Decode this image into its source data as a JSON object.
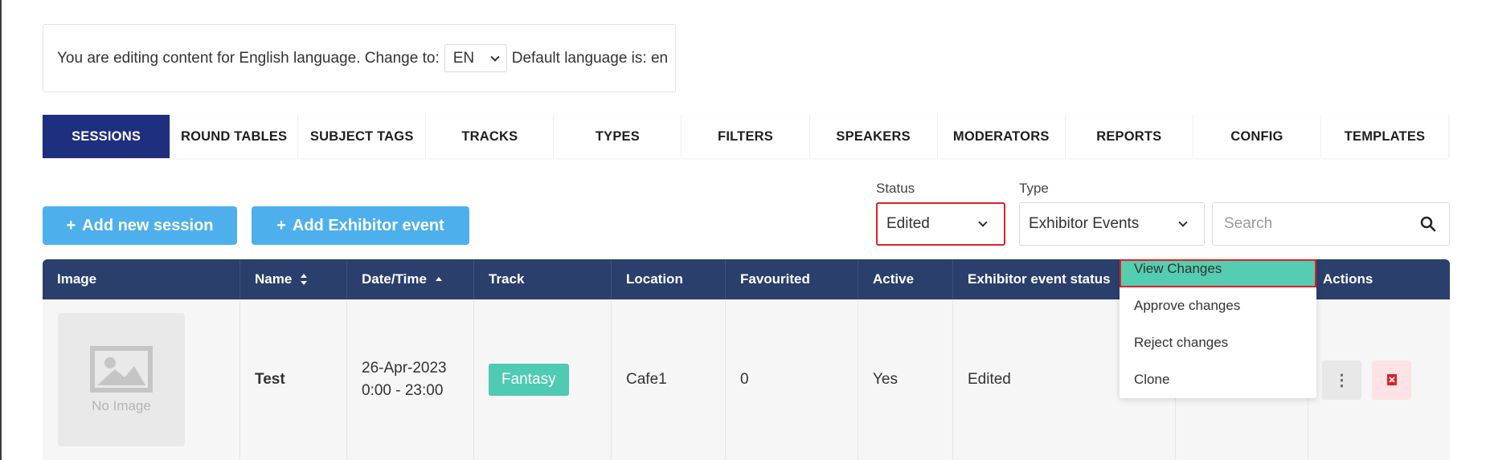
{
  "language_bar": {
    "prefix": "You are editing content for English language. Change to:",
    "selected": "EN",
    "suffix": "Default language is: en"
  },
  "tabs": [
    {
      "label": "SESSIONS",
      "active": true
    },
    {
      "label": "ROUND TABLES"
    },
    {
      "label": "SUBJECT TAGS"
    },
    {
      "label": "TRACKS"
    },
    {
      "label": "TYPES"
    },
    {
      "label": "FILTERS"
    },
    {
      "label": "SPEAKERS"
    },
    {
      "label": "MODERATORS"
    },
    {
      "label": "REPORTS"
    },
    {
      "label": "CONFIG"
    },
    {
      "label": "TEMPLATES"
    }
  ],
  "buttons": {
    "add_session": "Add new session",
    "add_exhibitor": "Add Exhibitor event",
    "plus": "+"
  },
  "filters": {
    "status_label": "Status",
    "status_value": "Edited",
    "type_label": "Type",
    "type_value": "Exhibitor Events",
    "search_placeholder": "Search"
  },
  "table": {
    "headers": [
      "Image",
      "Name",
      "Date/Time",
      "Track",
      "Location",
      "Favourited",
      "Active",
      "Exhibitor event status",
      "",
      "Actions"
    ],
    "row": {
      "image_text": "No Image",
      "name": "Test",
      "date": "26-Apr-2023",
      "time": "0:00 - 23:00",
      "track": "Fantasy",
      "location": "Cafe1",
      "favourited": "0",
      "active": "Yes",
      "status": "Edited",
      "kebab": "⋮"
    }
  },
  "menu": [
    "View Changes",
    "Approve changes",
    "Reject changes",
    "Clone"
  ],
  "colors": {
    "tab_active": "#1e2f7f",
    "header_bg": "#2b3f6d",
    "add_button": "#4db0ec",
    "track_badge": "#4fcab3",
    "menu_highlight": "#55cdb0",
    "focus_outline": "#e0202a"
  }
}
